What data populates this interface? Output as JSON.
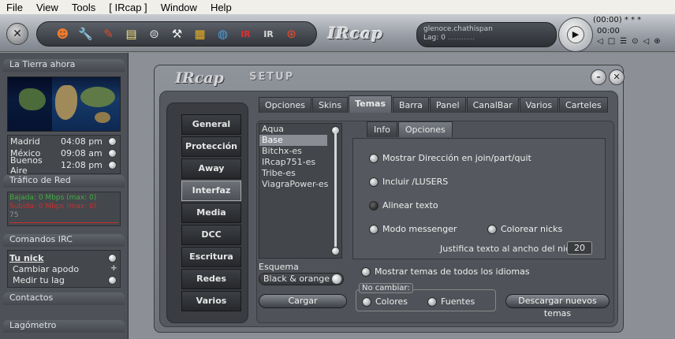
{
  "menu": [
    "File",
    "View",
    "Tools",
    "[ IRcap ]",
    "Window",
    "Help"
  ],
  "toolbar": {
    "logo": "IRcap",
    "server": "glenoce.chathispan",
    "lag": "Lag: 0",
    "lag_bar": "............",
    "time": "(00:00)",
    "stars": "* * *",
    "counter": "00:00",
    "icons": [
      "smiley-icon",
      "wrench-icon",
      "pencil-icon",
      "notes-icon",
      "server-icon",
      "tools-icon",
      "gift-icon",
      "globe-icon",
      "irc-icon",
      "ircap-icon",
      "lifebuoy-icon"
    ]
  },
  "left": {
    "earth_title": "La Tierra ahora",
    "clocks": [
      {
        "city": "Madrid",
        "time": "04:08 pm"
      },
      {
        "city": "México",
        "time": "09:08 am"
      },
      {
        "city": "Buenos Aire",
        "time": "12:08 pm"
      }
    ],
    "traffic_title": "Tráfico de Red",
    "traffic_down": "Bajada: 0 Mbps (max: 0)",
    "traffic_up": "Subida: 0 Mbps (max: 0)",
    "traffic_pct": "75",
    "commands_title": "Comandos IRC",
    "commands": [
      "Tu nick",
      "Cambiar apodo",
      "Medir tu lag"
    ],
    "contacts_title": "Contactos",
    "lagometer_title": "Lagómetro"
  },
  "dialog": {
    "logo": "IRcap",
    "title": "SETUP",
    "nav": [
      "General",
      "Protección",
      "Away",
      "Interfaz",
      "Media",
      "DCC",
      "Escritura",
      "Redes",
      "Varios"
    ],
    "nav_active": "Interfaz",
    "tabs": [
      "Opciones",
      "Skins",
      "Temas",
      "Barra",
      "Panel",
      "CanalBar",
      "Varios",
      "Carteles"
    ],
    "tab_active": "Temas",
    "themes": [
      "Aqua",
      "Base",
      "Bitchx-es",
      "IRcap751-es",
      "Tribe-es",
      "ViagraPower-es"
    ],
    "theme_selected": "Base",
    "esquema_label": "Esquema",
    "esquema_value": "Black & orange",
    "cargar": "Cargar",
    "subtabs": [
      "Info",
      "Opciones"
    ],
    "subtab_active": "Opciones",
    "options": {
      "mostrar_dir": "Mostrar Dirección en join/part/quit",
      "incluir": "Incluir /LUSERS",
      "alinear": "Alinear texto",
      "messenger": "Modo messenger",
      "colorear": "Colorear nicks",
      "justifica": "Justifica texto al ancho del nick",
      "justifica_value": "20",
      "mostrar_temas": "Mostrar temas de todos los idiomas"
    },
    "no_cambiar": "No cambiar:",
    "colores": "Colores",
    "fuentes": "Fuentes",
    "descargar": "Descargar nuevos temas"
  }
}
